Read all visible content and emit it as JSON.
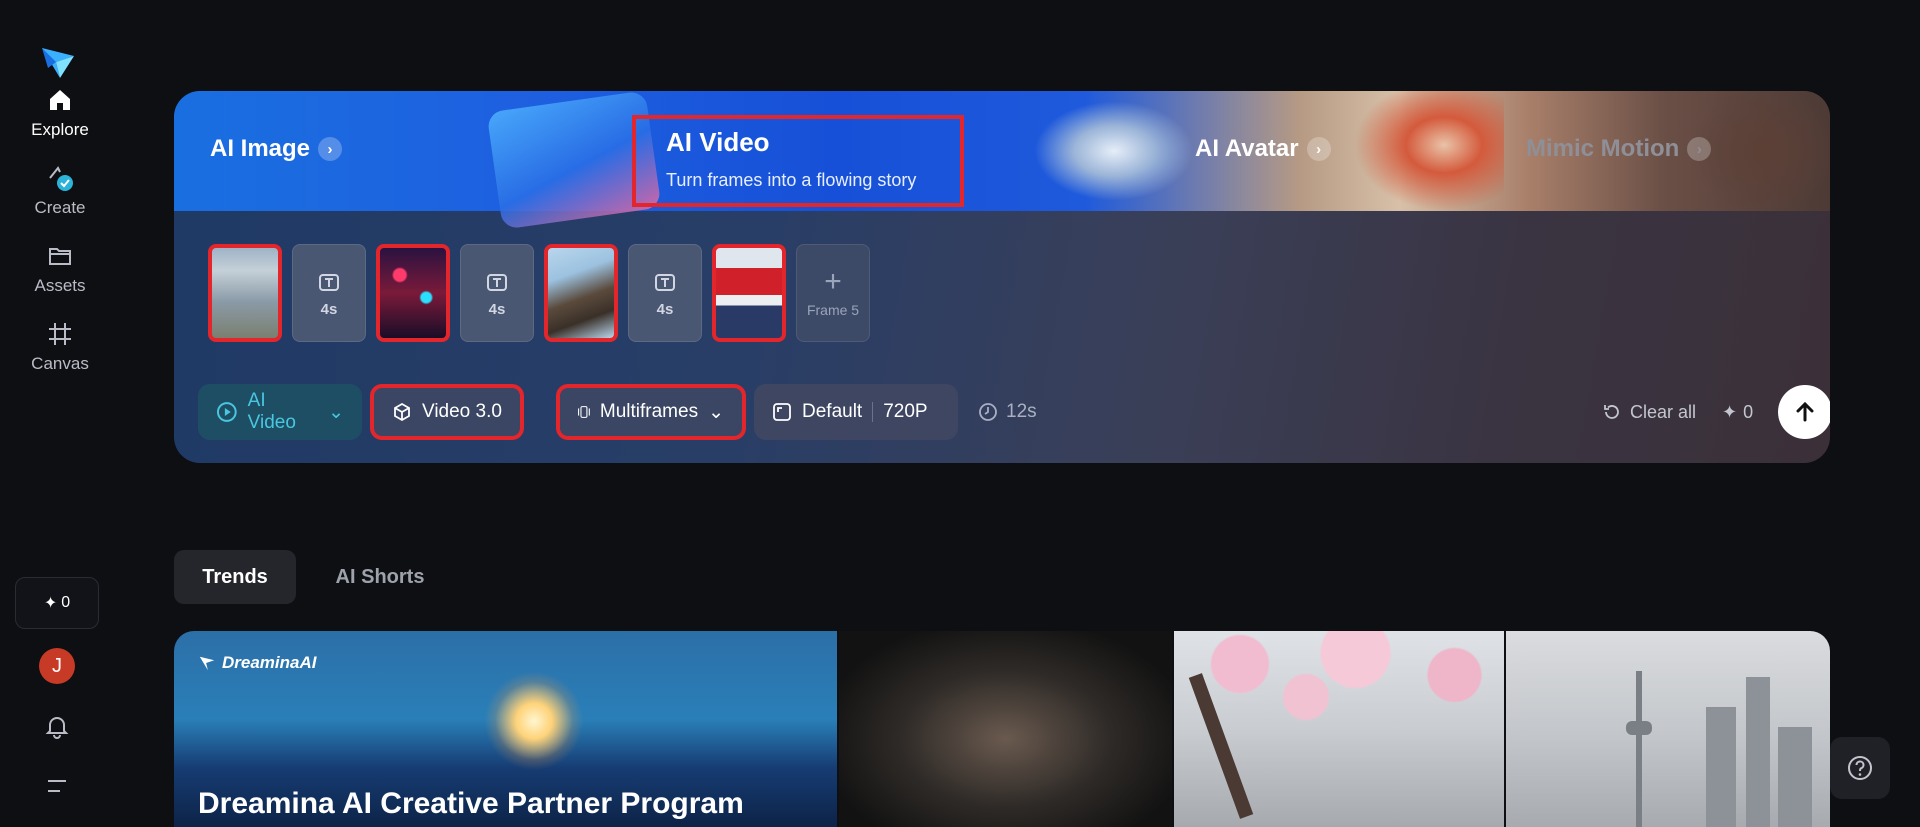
{
  "sidebar": {
    "nav": [
      {
        "label": "Explore",
        "icon": "home-icon",
        "active": true
      },
      {
        "label": "Create",
        "icon": "create-icon",
        "active": false
      },
      {
        "label": "Assets",
        "icon": "folder-icon",
        "active": false
      },
      {
        "label": "Canvas",
        "icon": "canvas-icon",
        "active": false
      }
    ],
    "credits": "0",
    "avatar_initial": "J"
  },
  "hero_tabs": {
    "ai_image": "AI Image",
    "ai_video_title": "AI Video",
    "ai_video_subtitle": "Turn frames into a flowing story",
    "ai_avatar": "AI Avatar",
    "mimic_motion": "Mimic Motion"
  },
  "frames": {
    "transition_duration": "4s",
    "add_label": "Frame 5"
  },
  "toolbar": {
    "mode_label": "AI Video",
    "model_label": "Video 3.0",
    "multiframes_label": "Multiframes",
    "ratio_label": "Default",
    "resolution_label": "720P",
    "duration_label": "12s",
    "clear_label": "Clear all",
    "credit_cost": "0"
  },
  "section_tabs": {
    "trends": "Trends",
    "ai_shorts": "AI Shorts"
  },
  "gallery": {
    "brand": "DreaminaAI",
    "headline": "Dreamina AI Creative Partner Program"
  },
  "colors": {
    "accent": "#49c7e0",
    "highlight_border": "#e3262c",
    "avatar_bg": "#c73a26"
  }
}
